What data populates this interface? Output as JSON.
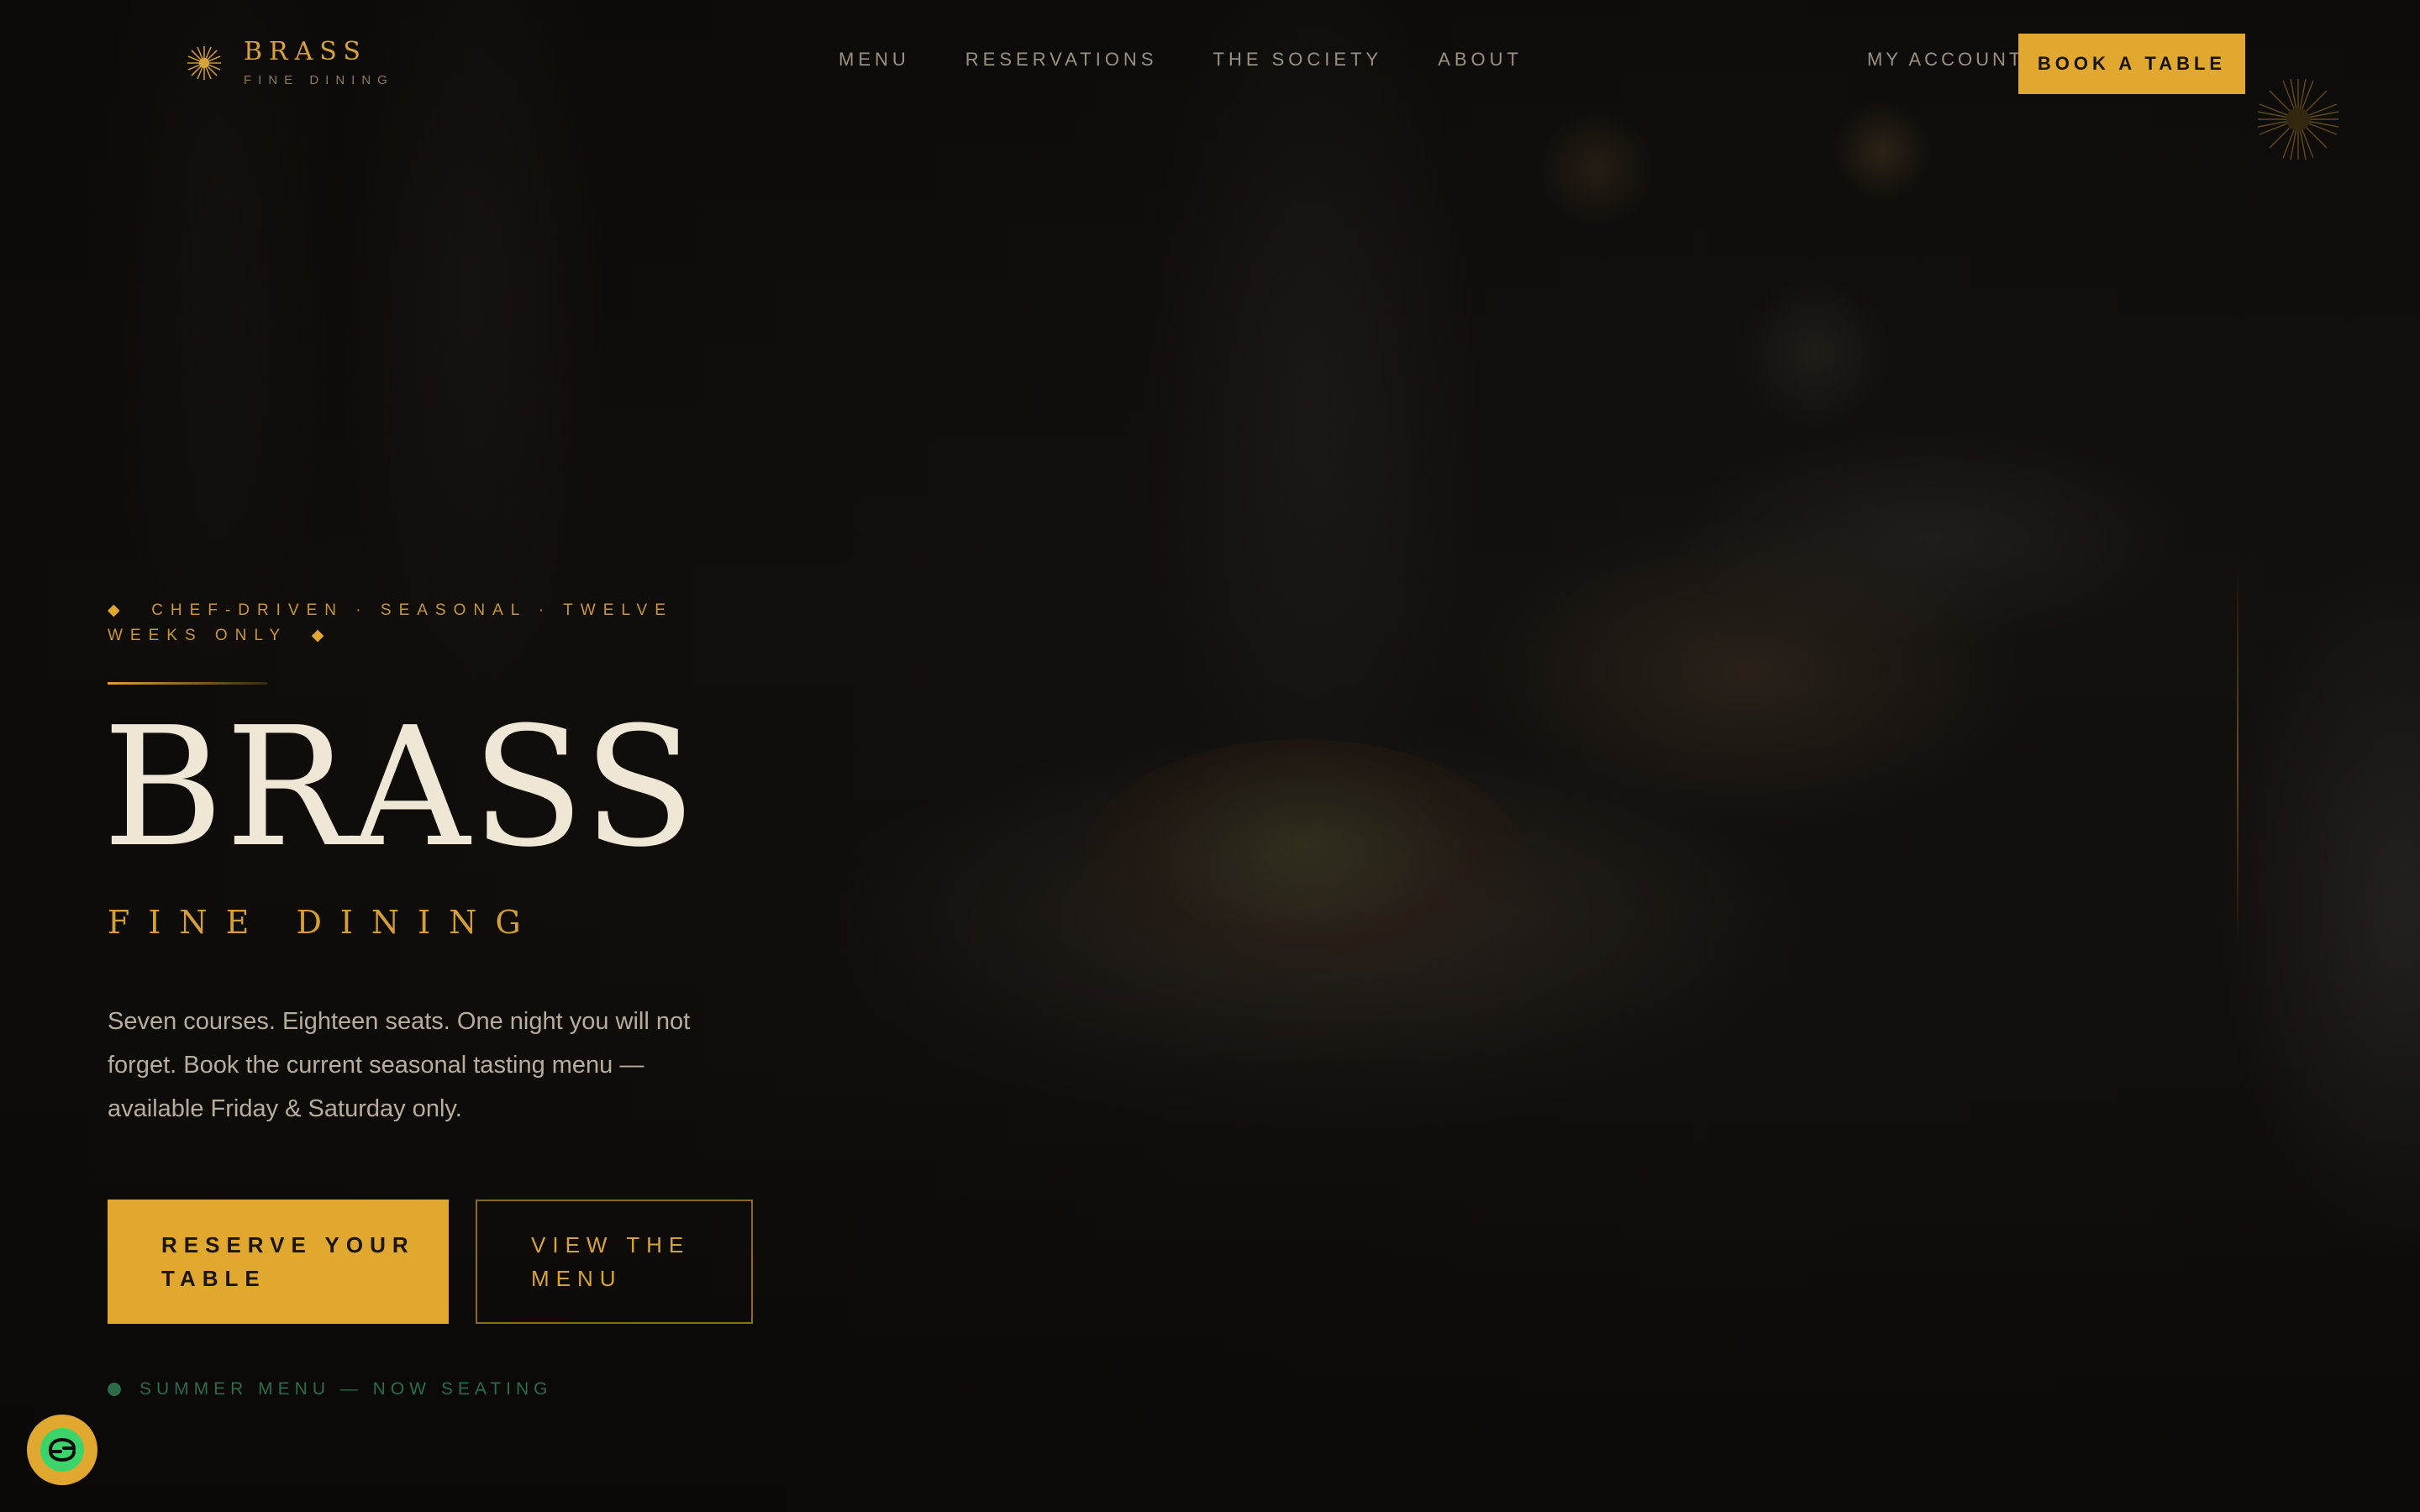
{
  "brand": {
    "name": "BRASS",
    "subtitle": "FINE DINING"
  },
  "nav": {
    "items": [
      "MENU",
      "RESERVATIONS",
      "THE SOCIETY",
      "ABOUT"
    ]
  },
  "header": {
    "account_label": "MY ACCOUNT",
    "book_label": "BOOK A TABLE"
  },
  "hero": {
    "eyebrow": "CHEF-DRIVEN · SEASONAL · TWELVE WEEKS ONLY",
    "title": "BRASS",
    "subtitle": "FINE DINING",
    "description": "Seven courses. Eighteen seats. One night you will not forget. Book the current seasonal tasting menu — available Friday & Saturday only.",
    "primary_cta": "RESERVE YOUR TABLE",
    "secondary_cta": "VIEW THE MENU",
    "status": "SUMMER MENU — NOW SEATING"
  },
  "icons": {
    "brand": "sunburst-icon",
    "corner": "sunburst-icon",
    "chat": "chat-widget-icon"
  },
  "colors": {
    "accent": "#e0a82e",
    "background": "#0d0b09",
    "status": "#2e6b4a",
    "title": "#efe7d6"
  }
}
